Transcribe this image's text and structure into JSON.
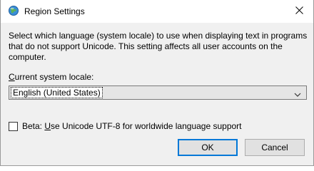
{
  "window": {
    "title": "Region Settings"
  },
  "description": "Select which language (system locale) to use when displaying text in programs that do not support Unicode. This setting affects all user accounts on the computer.",
  "locale": {
    "label_mnemonic": "C",
    "label_rest": "urrent system locale:",
    "selected": "English (United States)"
  },
  "beta": {
    "checked": false,
    "label_prefix": "Beta: ",
    "label_mnemonic": "U",
    "label_rest": "se Unicode UTF-8 for worldwide language support"
  },
  "buttons": {
    "ok": "OK",
    "cancel": "Cancel"
  },
  "colors": {
    "accent": "#0078d7",
    "dialog_bg": "#f0f0f0"
  },
  "icons": {
    "title": "globe-icon",
    "close": "close-icon",
    "dropdown": "chevron-down-icon"
  }
}
